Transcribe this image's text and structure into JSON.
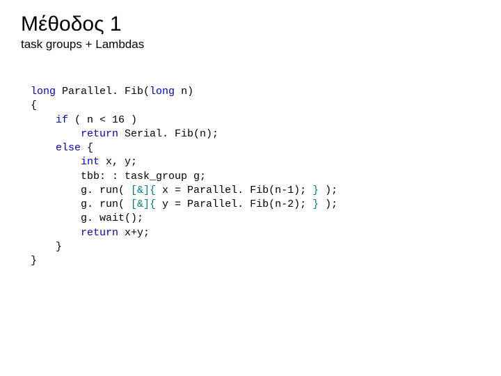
{
  "title": "Μέθοδος 1",
  "subtitle": "task groups + Lambdas",
  "code": {
    "l1a": "long",
    "l1b": " Parallel. Fib(",
    "l1c": "long",
    "l1d": " n)",
    "l2": "{",
    "l3a": "    if",
    "l3b": " ( n < 16 )",
    "l4a": "        return",
    "l4b": " Serial. Fib(n);",
    "l5a": "    else",
    "l5b": " {",
    "l6a": "        int",
    "l6b": " x, y;",
    "l7": "        tbb: : task_group g;",
    "l8a": "        g. run( ",
    "l8b": "[&]{",
    "l8c": " x = Parallel. Fib(n-1); ",
    "l8d": "}",
    "l8e": " );",
    "l9a": "        g. run( ",
    "l9b": "[&]{",
    "l9c": " y = Parallel. Fib(n-2); ",
    "l9d": "}",
    "l9e": " );",
    "l10": "        g. wait();",
    "l11a": "        return",
    "l11b": " x+y;",
    "l12": "    }",
    "l13": "}"
  }
}
